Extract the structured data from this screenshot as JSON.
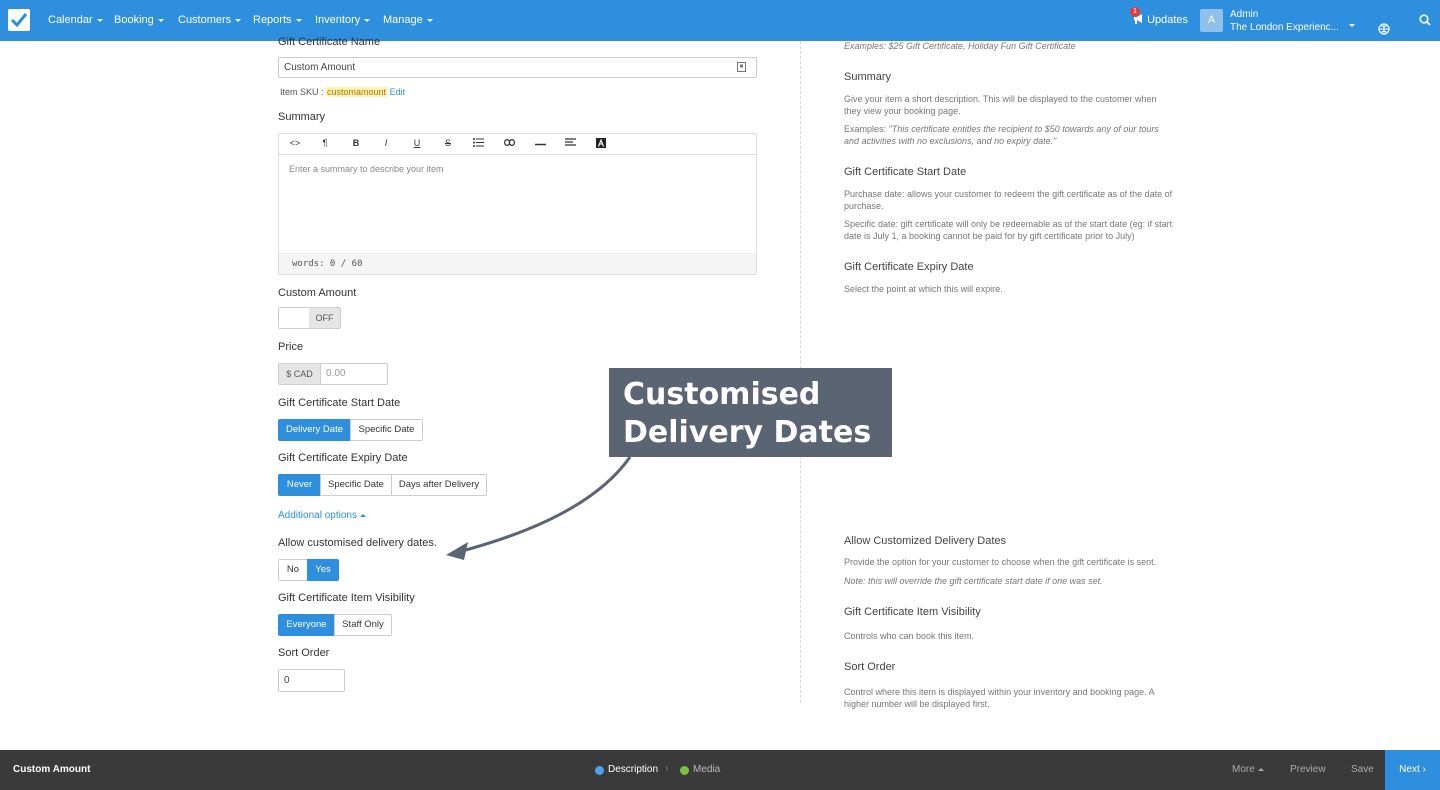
{
  "nav": {
    "items": [
      "Calendar",
      "Booking",
      "Customers",
      "Reports",
      "Inventory",
      "Manage"
    ],
    "updates_label": "Updates",
    "updates_count": "1",
    "avatar_letter": "A",
    "user_name": "Admin",
    "org_name": "The London Experienc..."
  },
  "form": {
    "name_label": "Gift Certificate Name",
    "name_value": "Custom Amount",
    "sku_prefix": "Item SKU :",
    "sku_value": "customamount",
    "sku_edit": "Edit",
    "summary_label": "Summary",
    "summary_placeholder": "Enter a summary to describe your item",
    "word_count": "words: 0 / 60",
    "custom_amount_label": "Custom Amount",
    "custom_amount_toggle": "OFF",
    "price_label": "Price",
    "price_addon": "$ CAD",
    "price_placeholder": "0.00",
    "start_date_label": "Gift Certificate Start Date",
    "start_date_options": [
      "Delivery Date",
      "Specific Date"
    ],
    "expiry_label": "Gift Certificate Expiry Date",
    "expiry_options": [
      "Never",
      "Specific Date",
      "Days after Delivery"
    ],
    "additional_options": "Additional options",
    "delivery_dates_label": "Allow customised delivery dates.",
    "delivery_options": [
      "No",
      "Yes"
    ],
    "visibility_label": "Gift Certificate Item Visibility",
    "visibility_options": [
      "Everyone",
      "Staff Only"
    ],
    "sort_label": "Sort Order",
    "sort_value": "0"
  },
  "help": {
    "name_examples": "Examples: $25 Gift Certificate, Holiday Fun Gift Certificate",
    "summary_title": "Summary",
    "summary_text": "Give your item a short description. This will be displayed to the customer when they view your booking page.",
    "summary_examples_prefix": "Examples: ",
    "summary_examples": "\"This certificate entitles the recipient to $50 towards any of our tours and activities with no exclusions, and no expiry date.\"",
    "start_title": "Gift Certificate Start Date",
    "start_text_1": "Purchase date: allows your customer to redeem the gift certificate as of the date of purchase.",
    "start_text_2": "Specific date: gift certificate will only be redeemable as of the start date (eg: if start date is July 1, a booking cannot be paid for by gift certificate prior to July)",
    "expiry_title": "Gift Certificate Expiry Date",
    "expiry_text": "Select the point at which this will expire.",
    "delivery_title": "Allow Customized Delivery Dates",
    "delivery_text": "Provide the option for your customer to choose when the gift certificate is sent.",
    "delivery_note": "Note: this will override the gift certificate start date if one was set.",
    "visibility_title": "Gift Certificate Item Visibility",
    "visibility_text": "Controls who can book this item.",
    "sort_title": "Sort Order",
    "sort_text": "Control where this item is displayed within your inventory and booking page. A higher number will be displayed first."
  },
  "callout": {
    "line1": "Customised",
    "line2": "Delivery Dates",
    "bg_color": "#5b6472"
  },
  "footer": {
    "title": "Custom Amount",
    "steps": [
      "Description",
      "Media"
    ],
    "more": "More",
    "preview": "Preview",
    "save": "Save",
    "next": "Next"
  },
  "colors": {
    "primary": "#2d8fde",
    "footer_bg": "#3a3a3a",
    "step_active": "#4aa3f0",
    "step_done": "#7cc242"
  }
}
